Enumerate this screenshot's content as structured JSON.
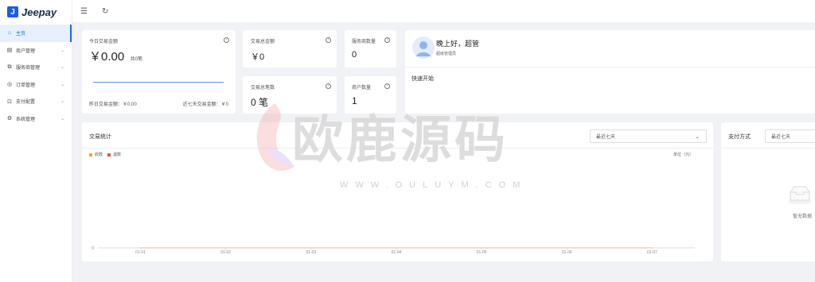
{
  "brand": {
    "logo_letter": "J",
    "name": "Jeepay"
  },
  "sidebar": {
    "items": [
      {
        "label": "主页",
        "icon": "home-icon",
        "glyph": "⌂",
        "active": true
      },
      {
        "label": "商户管理",
        "icon": "store-icon",
        "glyph": "▤",
        "chevron": "⌄"
      },
      {
        "label": "服务商管理",
        "icon": "provider-icon",
        "glyph": "⧉",
        "chevron": "⌄"
      },
      {
        "label": "订单管理",
        "icon": "order-icon",
        "glyph": "◎",
        "chevron": "⌄"
      },
      {
        "label": "支付配置",
        "icon": "payment-config-icon",
        "glyph": "⊡",
        "chevron": "⌄"
      },
      {
        "label": "系统管理",
        "icon": "system-icon",
        "glyph": "⚙",
        "chevron": "⌄"
      }
    ]
  },
  "topbar": {
    "menu_toggle_glyph": "☰",
    "refresh_glyph": "↻"
  },
  "today": {
    "label": "今日交易金额",
    "amount": "￥0.00",
    "count": "共0笔",
    "yesterday": "昨日交易金额：￥0.00",
    "last7": "近七天交易金额：￥0"
  },
  "total_amount": {
    "label": "交易总金额",
    "value": "￥0"
  },
  "total_count": {
    "label": "交易总笔数",
    "value": "0 笔"
  },
  "provider_count": {
    "label": "服务商数量",
    "value": "0"
  },
  "merchant_count": {
    "label": "商户数量",
    "value": "1"
  },
  "greeting": {
    "title": "晚上好，超管",
    "subtitle": "超级管理员",
    "quick_start": "快速开始"
  },
  "trade_stats": {
    "title": "交易统计",
    "range": "最近七天",
    "unit": "单位（元）",
    "legend": [
      {
        "name": "收款",
        "color": "#f5a623"
      },
      {
        "name": "退款",
        "color": "#e8553e"
      }
    ]
  },
  "pay_method": {
    "title": "支付方式",
    "range": "最近七天",
    "empty": "暂无数据"
  },
  "chart_data": {
    "type": "line",
    "x": [
      "01-01",
      "01-02",
      "01-03",
      "01-04",
      "01-05",
      "01-06",
      "01-07"
    ],
    "series": [
      {
        "name": "收款",
        "values": [
          0,
          0,
          0,
          0,
          0,
          0,
          0
        ]
      },
      {
        "name": "退款",
        "values": [
          0,
          0,
          0,
          0,
          0,
          0,
          0
        ]
      }
    ],
    "y_tick": "0"
  },
  "watermark": {
    "text": "欧鹿源码",
    "url": "WWW.OULUYM.COM"
  }
}
